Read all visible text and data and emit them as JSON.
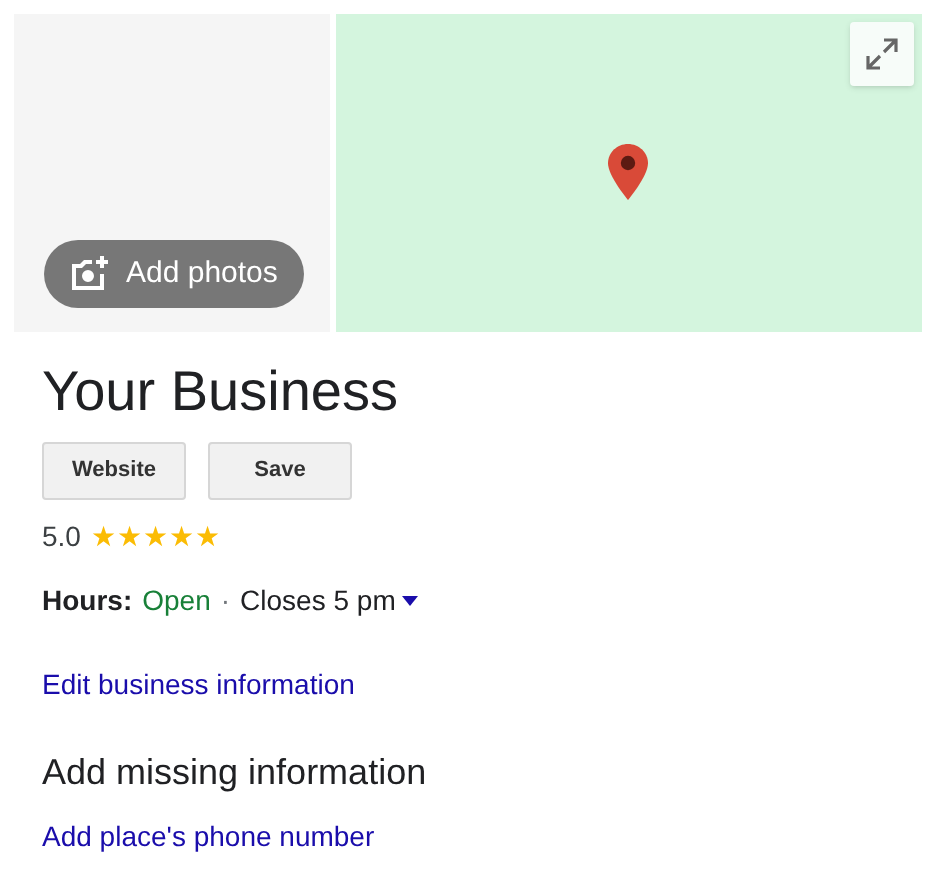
{
  "photos": {
    "button": "Add photos"
  },
  "map": {
    "expand_button": true
  },
  "business": {
    "name": "Your Business"
  },
  "buttons": [
    "Website",
    "Save"
  ],
  "rating": {
    "value": "5.0",
    "stars": 5
  },
  "hours": {
    "label": "Hours:",
    "status": "Open",
    "separator": "·",
    "closes": "Closes 5 pm"
  },
  "edit_link": "Edit business information",
  "missing": {
    "heading": "Add missing information",
    "links": [
      "Add place's phone number"
    ]
  }
}
